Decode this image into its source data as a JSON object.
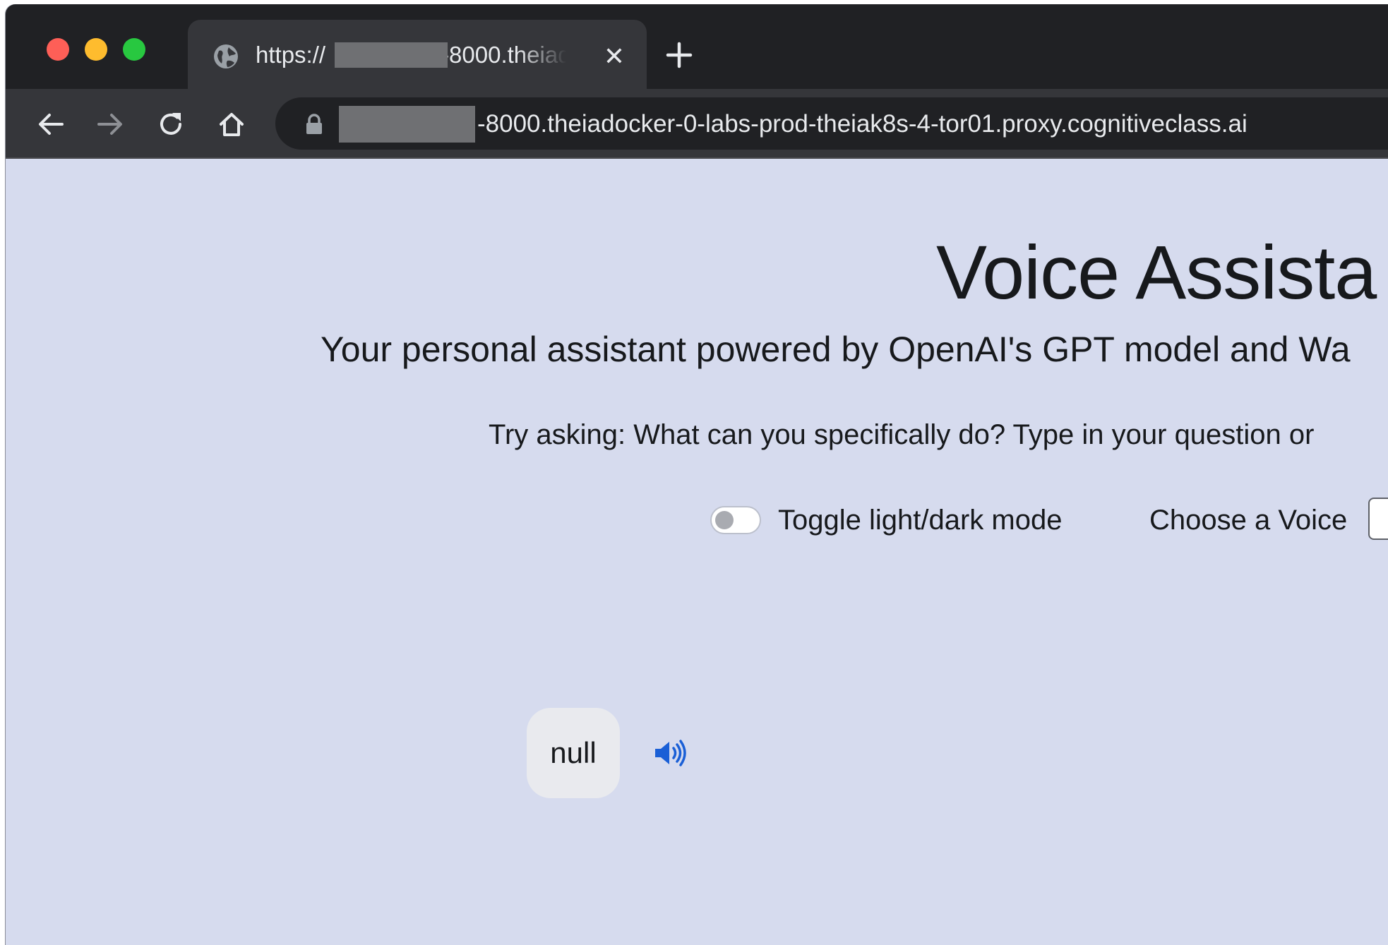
{
  "browser": {
    "tab": {
      "title_prefix": "https://",
      "title_suffix": "-8000.theiad",
      "close_glyph": "✕"
    },
    "address_bar": {
      "url_suffix": "-8000.theiadocker-0-labs-prod-theiak8s-4-tor01.proxy.cognitiveclass.ai"
    },
    "icons": [
      "back-icon",
      "forward-icon",
      "reload-icon",
      "home-icon",
      "lock-icon",
      "globe-icon",
      "plus-icon"
    ]
  },
  "page": {
    "heading": "Voice Assista",
    "subtitle": "Your personal assistant powered by OpenAI's GPT model and Wa",
    "hint": "Try asking: What can you specifically do? Type in your question or",
    "toggle_label": "Toggle light/dark mode",
    "voice_label": "Choose a Voice",
    "message_text": "null",
    "message_icon": "speaker-icon"
  },
  "colors": {
    "page_background": "#d6dbee",
    "chrome_dark": "#202124",
    "chrome_toolbar": "#35363a",
    "speaker_accent": "#1a5fd6"
  }
}
